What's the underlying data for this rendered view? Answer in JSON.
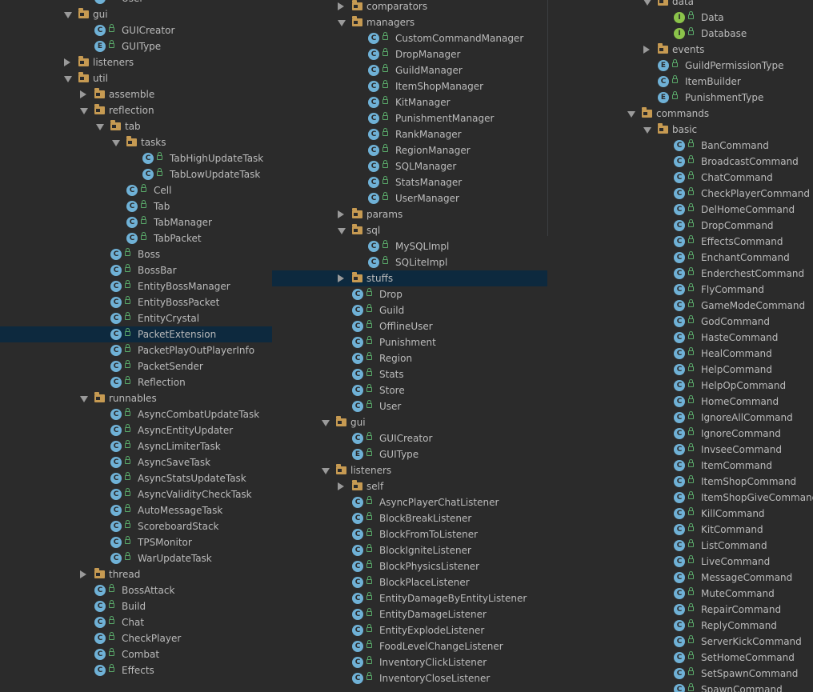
{
  "panels": [
    {
      "rows": [
        {
          "label": "User",
          "indent": 5,
          "kind": "class",
          "arrow": "none"
        },
        {
          "label": "gui",
          "indent": 4,
          "kind": "folder",
          "arrow": "open"
        },
        {
          "label": "GUICreator",
          "indent": 5,
          "kind": "class",
          "arrow": "none"
        },
        {
          "label": "GUIType",
          "indent": 5,
          "kind": "enum",
          "arrow": "none"
        },
        {
          "label": "listeners",
          "indent": 4,
          "kind": "folder",
          "arrow": "closed"
        },
        {
          "label": "util",
          "indent": 4,
          "kind": "folder",
          "arrow": "open"
        },
        {
          "label": "assemble",
          "indent": 5,
          "kind": "folder",
          "arrow": "closed"
        },
        {
          "label": "reflection",
          "indent": 5,
          "kind": "folder",
          "arrow": "open"
        },
        {
          "label": "tab",
          "indent": 6,
          "kind": "folder",
          "arrow": "open"
        },
        {
          "label": "tasks",
          "indent": 7,
          "kind": "folder",
          "arrow": "open"
        },
        {
          "label": "TabHighUpdateTask",
          "indent": 8,
          "kind": "class",
          "arrow": "none"
        },
        {
          "label": "TabLowUpdateTask",
          "indent": 8,
          "kind": "class",
          "arrow": "none"
        },
        {
          "label": "Cell",
          "indent": 7,
          "kind": "class",
          "arrow": "none"
        },
        {
          "label": "Tab",
          "indent": 7,
          "kind": "class",
          "arrow": "none"
        },
        {
          "label": "TabManager",
          "indent": 7,
          "kind": "class",
          "arrow": "none"
        },
        {
          "label": "TabPacket",
          "indent": 7,
          "kind": "class",
          "arrow": "none"
        },
        {
          "label": "Boss",
          "indent": 6,
          "kind": "class",
          "arrow": "none"
        },
        {
          "label": "BossBar",
          "indent": 6,
          "kind": "class",
          "arrow": "none"
        },
        {
          "label": "EntityBossManager",
          "indent": 6,
          "kind": "class",
          "arrow": "none"
        },
        {
          "label": "EntityBossPacket",
          "indent": 6,
          "kind": "class",
          "arrow": "none"
        },
        {
          "label": "EntityCrystal",
          "indent": 6,
          "kind": "class",
          "arrow": "none"
        },
        {
          "label": "PacketExtension",
          "indent": 6,
          "kind": "class",
          "arrow": "none",
          "selected": true
        },
        {
          "label": "PacketPlayOutPlayerInfo",
          "indent": 6,
          "kind": "class",
          "arrow": "none"
        },
        {
          "label": "PacketSender",
          "indent": 6,
          "kind": "class",
          "arrow": "none"
        },
        {
          "label": "Reflection",
          "indent": 6,
          "kind": "class",
          "arrow": "none"
        },
        {
          "label": "runnables",
          "indent": 5,
          "kind": "folder",
          "arrow": "open"
        },
        {
          "label": "AsyncCombatUpdateTask",
          "indent": 6,
          "kind": "class",
          "arrow": "none"
        },
        {
          "label": "AsyncEntityUpdater",
          "indent": 6,
          "kind": "class",
          "arrow": "none"
        },
        {
          "label": "AsyncLimiterTask",
          "indent": 6,
          "kind": "class",
          "arrow": "none"
        },
        {
          "label": "AsyncSaveTask",
          "indent": 6,
          "kind": "class",
          "arrow": "none"
        },
        {
          "label": "AsyncStatsUpdateTask",
          "indent": 6,
          "kind": "class",
          "arrow": "none"
        },
        {
          "label": "AsyncValidityCheckTask",
          "indent": 6,
          "kind": "class",
          "arrow": "none"
        },
        {
          "label": "AutoMessageTask",
          "indent": 6,
          "kind": "class",
          "arrow": "none"
        },
        {
          "label": "ScoreboardStack",
          "indent": 6,
          "kind": "class",
          "arrow": "none"
        },
        {
          "label": "TPSMonitor",
          "indent": 6,
          "kind": "class",
          "arrow": "none"
        },
        {
          "label": "WarUpdateTask",
          "indent": 6,
          "kind": "class",
          "arrow": "none"
        },
        {
          "label": "thread",
          "indent": 5,
          "kind": "folder",
          "arrow": "closed"
        },
        {
          "label": "BossAttack",
          "indent": 5,
          "kind": "class",
          "arrow": "none"
        },
        {
          "label": "Build",
          "indent": 5,
          "kind": "class",
          "arrow": "none"
        },
        {
          "label": "Chat",
          "indent": 5,
          "kind": "class",
          "arrow": "none"
        },
        {
          "label": "CheckPlayer",
          "indent": 5,
          "kind": "class",
          "arrow": "none"
        },
        {
          "label": "Combat",
          "indent": 5,
          "kind": "class",
          "arrow": "none"
        },
        {
          "label": "Effects",
          "indent": 5,
          "kind": "class",
          "arrow": "none"
        }
      ]
    },
    {
      "rows": [
        {
          "label": "comparators",
          "indent": 2,
          "kind": "folder",
          "arrow": "closed"
        },
        {
          "label": "managers",
          "indent": 2,
          "kind": "folder",
          "arrow": "open"
        },
        {
          "label": "CustomCommandManager",
          "indent": 3,
          "kind": "class",
          "arrow": "none"
        },
        {
          "label": "DropManager",
          "indent": 3,
          "kind": "class",
          "arrow": "none"
        },
        {
          "label": "GuildManager",
          "indent": 3,
          "kind": "class",
          "arrow": "none"
        },
        {
          "label": "ItemShopManager",
          "indent": 3,
          "kind": "class",
          "arrow": "none"
        },
        {
          "label": "KitManager",
          "indent": 3,
          "kind": "class",
          "arrow": "none"
        },
        {
          "label": "PunishmentManager",
          "indent": 3,
          "kind": "class",
          "arrow": "none"
        },
        {
          "label": "RankManager",
          "indent": 3,
          "kind": "class",
          "arrow": "none"
        },
        {
          "label": "RegionManager",
          "indent": 3,
          "kind": "class",
          "arrow": "none"
        },
        {
          "label": "SQLManager",
          "indent": 3,
          "kind": "class",
          "arrow": "none"
        },
        {
          "label": "StatsManager",
          "indent": 3,
          "kind": "class",
          "arrow": "none"
        },
        {
          "label": "UserManager",
          "indent": 3,
          "kind": "class",
          "arrow": "none"
        },
        {
          "label": "params",
          "indent": 2,
          "kind": "folder",
          "arrow": "closed"
        },
        {
          "label": "sql",
          "indent": 2,
          "kind": "folder",
          "arrow": "open"
        },
        {
          "label": "MySQLImpl",
          "indent": 3,
          "kind": "class",
          "arrow": "none"
        },
        {
          "label": "SQLiteImpl",
          "indent": 3,
          "kind": "class",
          "arrow": "none"
        },
        {
          "label": "stuffs",
          "indent": 2,
          "kind": "folder",
          "arrow": "closed",
          "selected": true
        },
        {
          "label": "Drop",
          "indent": 2,
          "kind": "class",
          "arrow": "none"
        },
        {
          "label": "Guild",
          "indent": 2,
          "kind": "class",
          "arrow": "none"
        },
        {
          "label": "OfflineUser",
          "indent": 2,
          "kind": "class",
          "arrow": "none"
        },
        {
          "label": "Punishment",
          "indent": 2,
          "kind": "class",
          "arrow": "none"
        },
        {
          "label": "Region",
          "indent": 2,
          "kind": "class",
          "arrow": "none"
        },
        {
          "label": "Stats",
          "indent": 2,
          "kind": "class",
          "arrow": "none"
        },
        {
          "label": "Store",
          "indent": 2,
          "kind": "class",
          "arrow": "none"
        },
        {
          "label": "User",
          "indent": 2,
          "kind": "class",
          "arrow": "none"
        },
        {
          "label": "gui",
          "indent": 1,
          "kind": "folder",
          "arrow": "open"
        },
        {
          "label": "GUICreator",
          "indent": 2,
          "kind": "class",
          "arrow": "none"
        },
        {
          "label": "GUIType",
          "indent": 2,
          "kind": "enum",
          "arrow": "none"
        },
        {
          "label": "listeners",
          "indent": 1,
          "kind": "folder",
          "arrow": "open"
        },
        {
          "label": "self",
          "indent": 2,
          "kind": "folder",
          "arrow": "closed"
        },
        {
          "label": "AsyncPlayerChatListener",
          "indent": 2,
          "kind": "class",
          "arrow": "none"
        },
        {
          "label": "BlockBreakListener",
          "indent": 2,
          "kind": "class",
          "arrow": "none"
        },
        {
          "label": "BlockFromToListener",
          "indent": 2,
          "kind": "class",
          "arrow": "none"
        },
        {
          "label": "BlockIgniteListener",
          "indent": 2,
          "kind": "class",
          "arrow": "none"
        },
        {
          "label": "BlockPhysicsListener",
          "indent": 2,
          "kind": "class",
          "arrow": "none"
        },
        {
          "label": "BlockPlaceListener",
          "indent": 2,
          "kind": "class",
          "arrow": "none"
        },
        {
          "label": "EntityDamageByEntityListener",
          "indent": 2,
          "kind": "class",
          "arrow": "none"
        },
        {
          "label": "EntityDamageListener",
          "indent": 2,
          "kind": "class",
          "arrow": "none"
        },
        {
          "label": "EntityExplodeListener",
          "indent": 2,
          "kind": "class",
          "arrow": "none"
        },
        {
          "label": "FoodLevelChangeListener",
          "indent": 2,
          "kind": "class",
          "arrow": "none"
        },
        {
          "label": "InventoryClickListener",
          "indent": 2,
          "kind": "class",
          "arrow": "none"
        },
        {
          "label": "InventoryCloseListener",
          "indent": 2,
          "kind": "class",
          "arrow": "none"
        }
      ]
    },
    {
      "rows": [
        {
          "label": "data",
          "indent": 1,
          "kind": "folder",
          "arrow": "open"
        },
        {
          "label": "Data",
          "indent": 2,
          "kind": "interface",
          "arrow": "none"
        },
        {
          "label": "Database",
          "indent": 2,
          "kind": "interface",
          "arrow": "none"
        },
        {
          "label": "events",
          "indent": 1,
          "kind": "folder",
          "arrow": "closed"
        },
        {
          "label": "GuildPermissionType",
          "indent": 1,
          "kind": "enum",
          "arrow": "none"
        },
        {
          "label": "ItemBuilder",
          "indent": 1,
          "kind": "class",
          "arrow": "none"
        },
        {
          "label": "PunishmentType",
          "indent": 1,
          "kind": "enum",
          "arrow": "none"
        },
        {
          "label": "commands",
          "indent": 0,
          "kind": "folder",
          "arrow": "open"
        },
        {
          "label": "basic",
          "indent": 1,
          "kind": "folder",
          "arrow": "open"
        },
        {
          "label": "BanCommand",
          "indent": 2,
          "kind": "class",
          "arrow": "none"
        },
        {
          "label": "BroadcastCommand",
          "indent": 2,
          "kind": "class",
          "arrow": "none"
        },
        {
          "label": "ChatCommand",
          "indent": 2,
          "kind": "class",
          "arrow": "none"
        },
        {
          "label": "CheckPlayerCommand",
          "indent": 2,
          "kind": "class",
          "arrow": "none"
        },
        {
          "label": "DelHomeCommand",
          "indent": 2,
          "kind": "class",
          "arrow": "none"
        },
        {
          "label": "DropCommand",
          "indent": 2,
          "kind": "class",
          "arrow": "none"
        },
        {
          "label": "EffectsCommand",
          "indent": 2,
          "kind": "class",
          "arrow": "none"
        },
        {
          "label": "EnchantCommand",
          "indent": 2,
          "kind": "class",
          "arrow": "none"
        },
        {
          "label": "EnderchestCommand",
          "indent": 2,
          "kind": "class",
          "arrow": "none"
        },
        {
          "label": "FlyCommand",
          "indent": 2,
          "kind": "class",
          "arrow": "none"
        },
        {
          "label": "GameModeCommand",
          "indent": 2,
          "kind": "class",
          "arrow": "none"
        },
        {
          "label": "GodCommand",
          "indent": 2,
          "kind": "class",
          "arrow": "none"
        },
        {
          "label": "HasteCommand",
          "indent": 2,
          "kind": "class",
          "arrow": "none"
        },
        {
          "label": "HealCommand",
          "indent": 2,
          "kind": "class",
          "arrow": "none"
        },
        {
          "label": "HelpCommand",
          "indent": 2,
          "kind": "class",
          "arrow": "none"
        },
        {
          "label": "HelpOpCommand",
          "indent": 2,
          "kind": "class",
          "arrow": "none"
        },
        {
          "label": "HomeCommand",
          "indent": 2,
          "kind": "class",
          "arrow": "none"
        },
        {
          "label": "IgnoreAllCommand",
          "indent": 2,
          "kind": "class",
          "arrow": "none"
        },
        {
          "label": "IgnoreCommand",
          "indent": 2,
          "kind": "class",
          "arrow": "none"
        },
        {
          "label": "InvseeCommand",
          "indent": 2,
          "kind": "class",
          "arrow": "none"
        },
        {
          "label": "ItemCommand",
          "indent": 2,
          "kind": "class",
          "arrow": "none"
        },
        {
          "label": "ItemShopCommand",
          "indent": 2,
          "kind": "class",
          "arrow": "none"
        },
        {
          "label": "ItemShopGiveCommand",
          "indent": 2,
          "kind": "class",
          "arrow": "none"
        },
        {
          "label": "KillCommand",
          "indent": 2,
          "kind": "class",
          "arrow": "none"
        },
        {
          "label": "KitCommand",
          "indent": 2,
          "kind": "class",
          "arrow": "none"
        },
        {
          "label": "ListCommand",
          "indent": 2,
          "kind": "class",
          "arrow": "none"
        },
        {
          "label": "LiveCommand",
          "indent": 2,
          "kind": "class",
          "arrow": "none"
        },
        {
          "label": "MessageCommand",
          "indent": 2,
          "kind": "class",
          "arrow": "none"
        },
        {
          "label": "MuteCommand",
          "indent": 2,
          "kind": "class",
          "arrow": "none"
        },
        {
          "label": "RepairCommand",
          "indent": 2,
          "kind": "class",
          "arrow": "none"
        },
        {
          "label": "ReplyCommand",
          "indent": 2,
          "kind": "class",
          "arrow": "none"
        },
        {
          "label": "ServerKickCommand",
          "indent": 2,
          "kind": "class",
          "arrow": "none"
        },
        {
          "label": "SetHomeCommand",
          "indent": 2,
          "kind": "class",
          "arrow": "none"
        },
        {
          "label": "SetSpawnCommand",
          "indent": 2,
          "kind": "class",
          "arrow": "none"
        },
        {
          "label": "SpawnCommand",
          "indent": 2,
          "kind": "class",
          "arrow": "none"
        }
      ]
    }
  ],
  "colors": {
    "background": "#2b2b2b",
    "text": "#bbbbbb",
    "selection": "#0d293e",
    "folder": "#c69a52",
    "class_badge": "#6fb1d6",
    "interface_badge": "#8bc34a",
    "lock": "#59a869"
  },
  "icons": {
    "folder": "folder-icon",
    "class": "class-icon",
    "enum": "enum-icon",
    "interface": "interface-icon",
    "lock": "lock-icon",
    "expanded": "chevron-down-icon",
    "collapsed": "chevron-right-icon"
  },
  "badge_letters": {
    "class": "C",
    "enum": "E",
    "interface": "I"
  }
}
